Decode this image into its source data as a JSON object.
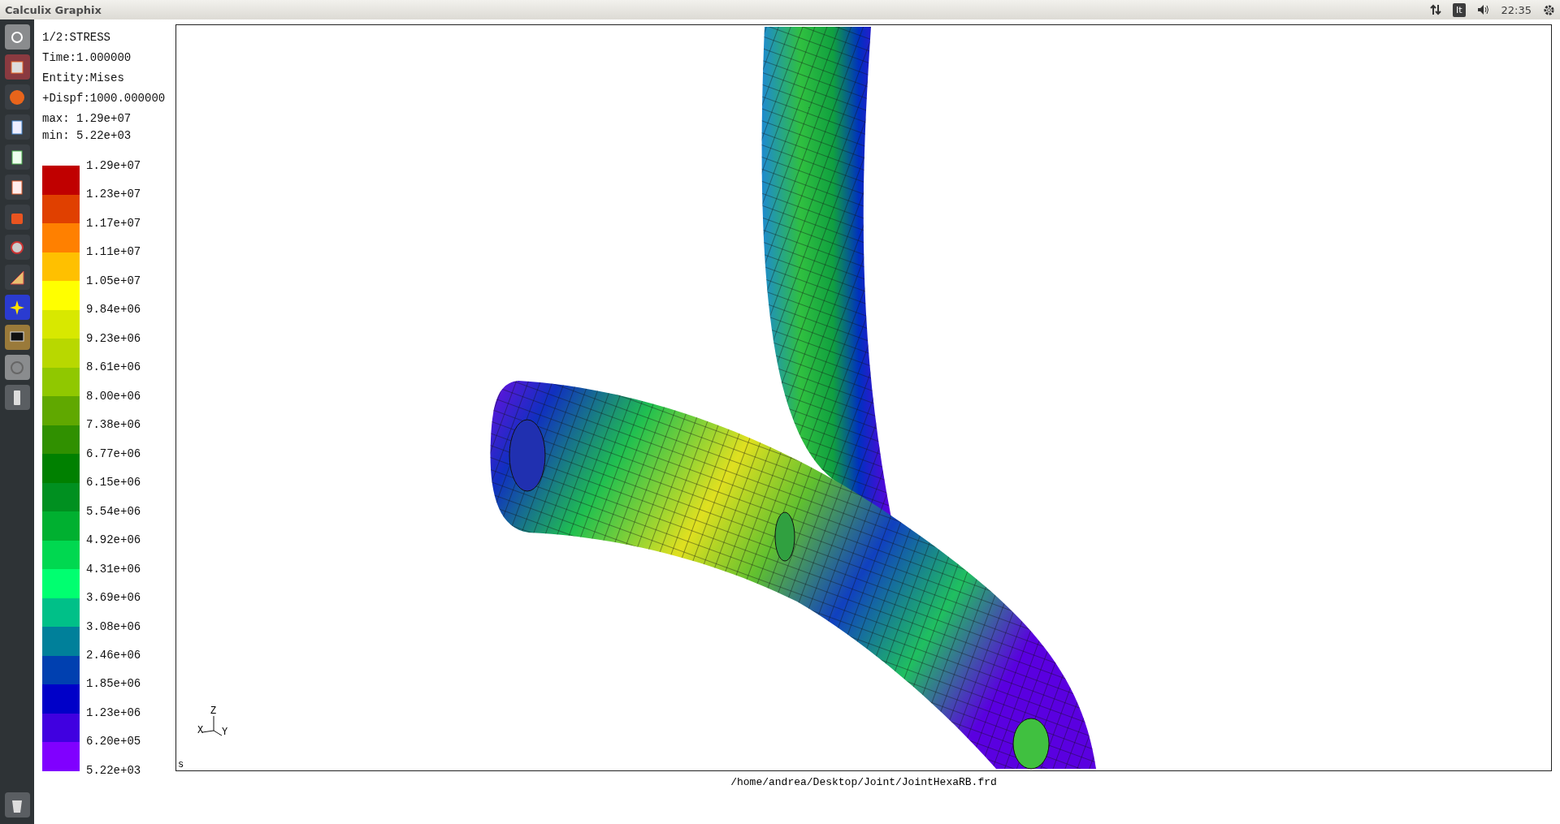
{
  "window": {
    "title": "Calculix Graphix"
  },
  "top_bar": {
    "keyboard_layout": "It",
    "clock": "22:35"
  },
  "info": [
    "1/2:STRESS",
    "Time:1.000000",
    "Entity:Mises",
    "+Dispf:1000.000000",
    "max: 1.29e+07",
    "min: 5.22e+03"
  ],
  "legend": {
    "bands": [
      {
        "color": "#c00000"
      },
      {
        "color": "#e04000"
      },
      {
        "color": "#ff8000"
      },
      {
        "color": "#ffc000"
      },
      {
        "color": "#ffff00"
      },
      {
        "color": "#d8e800"
      },
      {
        "color": "#b8d800"
      },
      {
        "color": "#90c800"
      },
      {
        "color": "#60a800"
      },
      {
        "color": "#309000"
      },
      {
        "color": "#008000"
      },
      {
        "color": "#009020"
      },
      {
        "color": "#00b030"
      },
      {
        "color": "#00d850"
      },
      {
        "color": "#00ff70"
      },
      {
        "color": "#00c088"
      },
      {
        "color": "#00809a"
      },
      {
        "color": "#0040b0"
      },
      {
        "color": "#0000c8"
      },
      {
        "color": "#4000e0"
      },
      {
        "color": "#8000ff"
      }
    ],
    "labels": [
      "1.29e+07",
      "1.23e+07",
      "1.17e+07",
      "1.11e+07",
      "1.05e+07",
      "9.84e+06",
      "9.23e+06",
      "8.61e+06",
      "8.00e+06",
      "7.38e+06",
      "6.77e+06",
      "6.15e+06",
      "5.54e+06",
      "4.92e+06",
      "4.31e+06",
      "3.69e+06",
      "3.08e+06",
      "2.46e+06",
      "1.85e+06",
      "1.23e+06",
      "6.20e+05",
      "5.22e+03"
    ]
  },
  "viewport": {
    "axes": {
      "x": "X",
      "y": "Y",
      "z": "Z"
    },
    "corner_mark": "s"
  },
  "status_bar": {
    "file_path": "/home/andrea/Desktop/Joint/JointHexaRB.frd"
  }
}
